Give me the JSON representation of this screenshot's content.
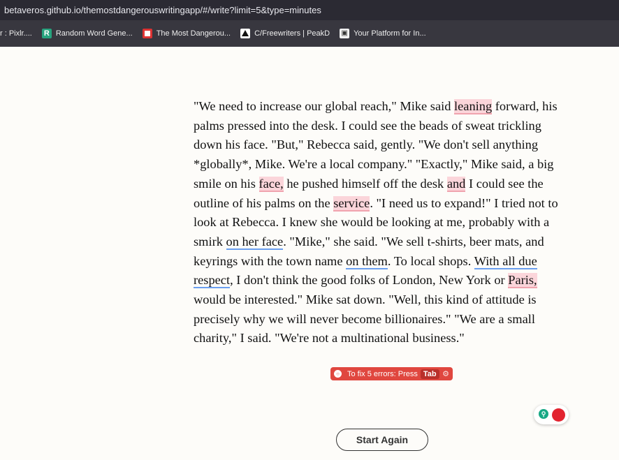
{
  "browser": {
    "url": "betaveros.github.io/themostdangerouswritingapp/#/write?limit=5&type=minutes",
    "bookmarks": [
      {
        "label": "r : Pixlr....",
        "icon": "none"
      },
      {
        "label": "Random Word Gene...",
        "icon": "r-logo-icon"
      },
      {
        "label": "The Most Dangerou...",
        "icon": "dangerous-app-icon"
      },
      {
        "label": "C/Freewriters | PeakD",
        "icon": "peakd-icon"
      },
      {
        "label": "Your Platform for In...",
        "icon": "platform-icon"
      }
    ]
  },
  "story": {
    "segments": [
      {
        "text": "\"We need to increase our global reach,\" Mike said ",
        "mark": "none"
      },
      {
        "text": "leaning",
        "mark": "error"
      },
      {
        "text": " forward, his palms pressed into the desk. I could see the beads of sweat trickling down his face. \"But,\" Rebecca said, gently. \"We don't sell anything *globally*, Mike. We're a local company.\" \"Exactly,\" Mike said, a big smile on his ",
        "mark": "none"
      },
      {
        "text": "face,",
        "mark": "error"
      },
      {
        "text": " he pushed himself off the desk ",
        "mark": "none"
      },
      {
        "text": "and",
        "mark": "error"
      },
      {
        "text": " I could see the outline of his palms on the ",
        "mark": "none"
      },
      {
        "text": "service",
        "mark": "error"
      },
      {
        "text": ". \"I need us to expand!\" I tried not to look at Rebecca. I knew she would be looking at me, probably with a smirk ",
        "mark": "none"
      },
      {
        "text": "on her face",
        "mark": "style"
      },
      {
        "text": ". \"Mike,\" she said. \"We sell t-shirts, beer mats, and keyrings with the town name ",
        "mark": "none"
      },
      {
        "text": "on them",
        "mark": "style"
      },
      {
        "text": ". To local shops. ",
        "mark": "none"
      },
      {
        "text": "With all due respect",
        "mark": "style"
      },
      {
        "text": ", I don't think the good folks of London, New York or ",
        "mark": "none"
      },
      {
        "text": "Paris,",
        "mark": "error"
      },
      {
        "text": " would be interested.\" Mike sat down. \"Well, this kind of attitude is precisely why we will never become billionaires.\" \"We are a small charity,\" I said. \"We're not a multinational business.\"",
        "mark": "none"
      }
    ]
  },
  "grammar": {
    "fix_text": "To fix 5 errors: Press",
    "fix_key": "Tab",
    "accent": "#e0473f"
  },
  "actions": {
    "start_again": "Start Again"
  }
}
